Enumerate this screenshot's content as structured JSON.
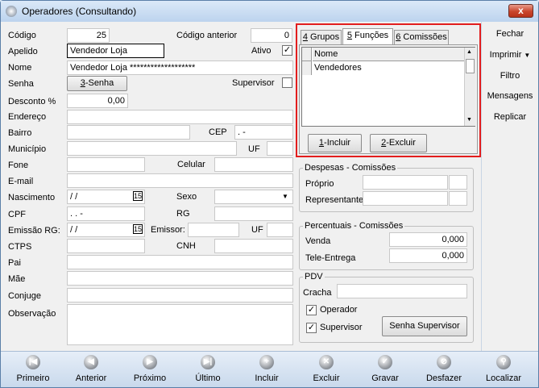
{
  "window": {
    "title": "Operadores (Consultando)",
    "close_glyph": "x"
  },
  "form": {
    "codigo": {
      "label": "Código",
      "value": "25"
    },
    "codigo_anterior": {
      "label": "Código anterior",
      "value": "0"
    },
    "apelido": {
      "label": "Apelido",
      "value": "Vendedor Loja"
    },
    "ativo": {
      "label": "Ativo",
      "checked": true
    },
    "nome": {
      "label": "Nome",
      "value": "Vendedor Loja *******************"
    },
    "senha": {
      "label": "Senha",
      "button": "3-Senha",
      "button_ul": "3",
      "button_rest": "-Senha"
    },
    "supervisor": {
      "label": "Supervisor",
      "checked": false
    },
    "desconto": {
      "label": "Desconto %",
      "value": "0,00"
    },
    "endereco": {
      "label": "Endereço",
      "value": ""
    },
    "bairro": {
      "label": "Bairro",
      "value": ""
    },
    "cep": {
      "label": "CEP",
      "value": "  .   -"
    },
    "municipio": {
      "label": "Município",
      "value": ""
    },
    "uf": {
      "label": "UF",
      "value": ""
    },
    "fone": {
      "label": "Fone",
      "value": ""
    },
    "celular": {
      "label": "Celular",
      "value": ""
    },
    "email": {
      "label": "E-mail",
      "value": ""
    },
    "nascimento": {
      "label": "Nascimento",
      "value": "  /  /",
      "cal": "15"
    },
    "sexo": {
      "label": "Sexo",
      "value": ""
    },
    "cpf": {
      "label": "CPF",
      "value": "   .   .   -"
    },
    "rg": {
      "label": "RG",
      "value": ""
    },
    "emissao_rg": {
      "label": "Emissão RG:",
      "value": "  /  /",
      "cal": "15"
    },
    "emissor": {
      "label": "Emissor:",
      "value": ""
    },
    "uf2": {
      "label": "UF",
      "value": ""
    },
    "ctps": {
      "label": "CTPS",
      "value": ""
    },
    "cnh": {
      "label": "CNH",
      "value": ""
    },
    "pai": {
      "label": "Pai",
      "value": ""
    },
    "mae": {
      "label": "Mãe",
      "value": ""
    },
    "conjuge": {
      "label": "Conjuge",
      "value": ""
    },
    "observacao": {
      "label": "Observação",
      "value": ""
    }
  },
  "tabs": [
    {
      "ul": "4",
      "rest": " Grupos"
    },
    {
      "ul": "5",
      "rest": " Funções"
    },
    {
      "ul": "6",
      "rest": " Comissões"
    }
  ],
  "grid": {
    "header": "Nome",
    "rows": [
      "Vendedores"
    ]
  },
  "tab_buttons": {
    "incluir": {
      "ul": "1",
      "rest": "-Incluir"
    },
    "excluir": {
      "ul": "2",
      "rest": "-Excluir"
    }
  },
  "despesas": {
    "title": "Despesas - Comissões",
    "proprio": "Próprio",
    "representante": "Representante"
  },
  "percentuais": {
    "title": "Percentuais - Comissões",
    "venda": {
      "label": "Venda",
      "value": "0,000"
    },
    "tele": {
      "label": "Tele-Entrega",
      "value": "0,000"
    }
  },
  "pdv": {
    "title": "PDV",
    "cracha": "Cracha",
    "operador": {
      "label": "Operador",
      "checked": true
    },
    "supervisor": {
      "label": "Supervisor",
      "checked": true
    },
    "senha_button": "Senha Supervisor"
  },
  "side_menu": [
    "Fechar",
    "Imprimir",
    "Filtro",
    "Mensagens",
    "Replicar"
  ],
  "imprimir_arrow": "▼",
  "toolbar": [
    {
      "label": "Primeiro",
      "icon": "first-icon",
      "glyph": "|◀"
    },
    {
      "label": "Anterior",
      "icon": "prev-icon",
      "glyph": "◀"
    },
    {
      "label": "Próximo",
      "icon": "next-icon",
      "glyph": "▶"
    },
    {
      "label": "Último",
      "icon": "last-icon",
      "glyph": "▶|"
    },
    {
      "label": "Incluir",
      "icon": "plus-icon",
      "glyph": "+"
    },
    {
      "label": "Excluir",
      "icon": "x-icon",
      "glyph": "✕"
    },
    {
      "label": "Gravar",
      "icon": "check-icon",
      "glyph": "✓"
    },
    {
      "label": "Desfazer",
      "icon": "undo-icon",
      "glyph": "⊘"
    },
    {
      "label": "Localizar",
      "icon": "search-icon",
      "glyph": "⚲"
    }
  ]
}
